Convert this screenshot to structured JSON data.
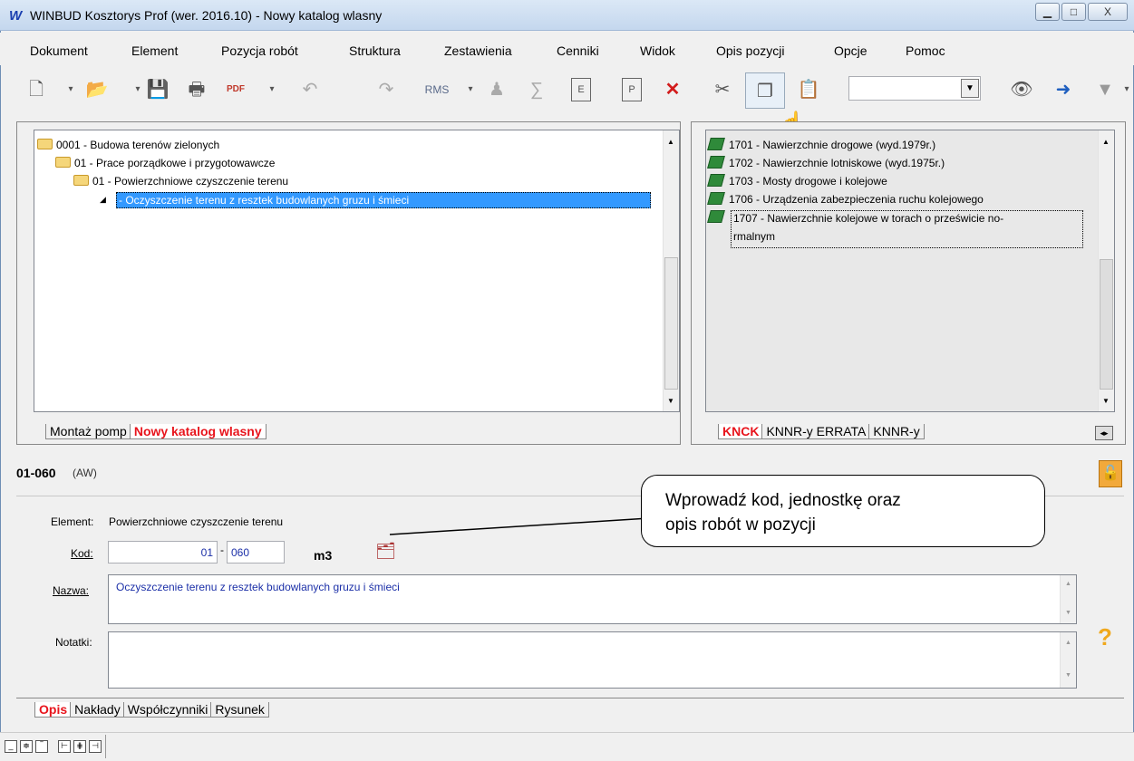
{
  "window": {
    "title": "WINBUD Kosztorys Prof (wer. 2016.10) - Nowy katalog wlasny",
    "app_icon": "W",
    "controls": [
      "minimize",
      "maximize",
      "close"
    ]
  },
  "menu": [
    {
      "label": "Dokument"
    },
    {
      "label": "Element"
    },
    {
      "label": "Pozycja robót"
    },
    {
      "label": "Struktura"
    },
    {
      "label": "Zestawienia"
    },
    {
      "label": "Cenniki"
    },
    {
      "label": "Widok"
    },
    {
      "label": "Opis pozycji"
    },
    {
      "label": "Opcje"
    },
    {
      "label": "Pomoc"
    }
  ],
  "toolbar": {
    "icons": [
      "new-document-icon",
      "open-folder-icon",
      "save-icon",
      "print-icon",
      "pdf-icon",
      "undo-icon",
      "redo-icon",
      "rms-icon",
      "person-icon",
      "sum-icon",
      "e-icon",
      "p-icon",
      "delete-icon",
      "cut-icon",
      "copy-icon",
      "paste-icon",
      "binoculars-icon",
      "find-next-icon",
      "filter-icon"
    ],
    "rms_label": "RMS",
    "e_label": "E",
    "p_label": "P",
    "combo_value": ""
  },
  "left_tree": {
    "rows": [
      {
        "label": "0001 - Budowa terenów zielonych"
      },
      {
        "label": "01 - Prace porządkowe i przygotowawcze"
      },
      {
        "label": "01 - Powierzchniowe czyszczenie terenu"
      },
      {
        "label": "- Oczyszczenie terenu z resztek budowlanych gruzu i śmieci"
      }
    ],
    "tabs": [
      "Montaż pomp",
      "Nowy katalog wlasny"
    ],
    "active_tab": "Nowy katalog wlasny"
  },
  "right_tree": {
    "rows": [
      {
        "label": "1701 - Nawierzchnie drogowe (wyd.1979r.)"
      },
      {
        "label": "1702 - Nawierzchnie lotniskowe (wyd.1975r.)"
      },
      {
        "label": "1703 - Mosty drogowe i kolejowe"
      },
      {
        "label": "1706 - Urządzenia zabezpieczenia ruchu kolejowego"
      },
      {
        "label": "1707 - Nawierzchnie kolejowe w torach o prześwicie no-"
      },
      {
        "label": "rmalnym"
      }
    ],
    "tabs": [
      "KNCK",
      "KNNR-y ERRATA",
      "KNNR-y"
    ],
    "active_tab": "KNCK"
  },
  "position": {
    "code": "01-060",
    "suffix": "(AW)",
    "element_label": "Element:",
    "element_value": "Powierzchniowe czyszczenie terenu",
    "kod_label": "Kod:",
    "kod_part1": "01",
    "kod_part2": "060",
    "unit": "m3",
    "nazwa_label": "Nazwa:",
    "nazwa_value": "Oczyszczenie terenu z resztek budowlanych gruzu i śmieci",
    "notatki_label": "Notatki:",
    "notatki_value": ""
  },
  "callout": {
    "line1": "Wprowadź kod, jednostkę oraz",
    "line2": "opis robót w pozycji"
  },
  "bottom_tabs": [
    "Opis",
    "Nakłady",
    "Współczynniki",
    "Rysunek"
  ],
  "bottom_active_tab": "Opis",
  "help": "?"
}
